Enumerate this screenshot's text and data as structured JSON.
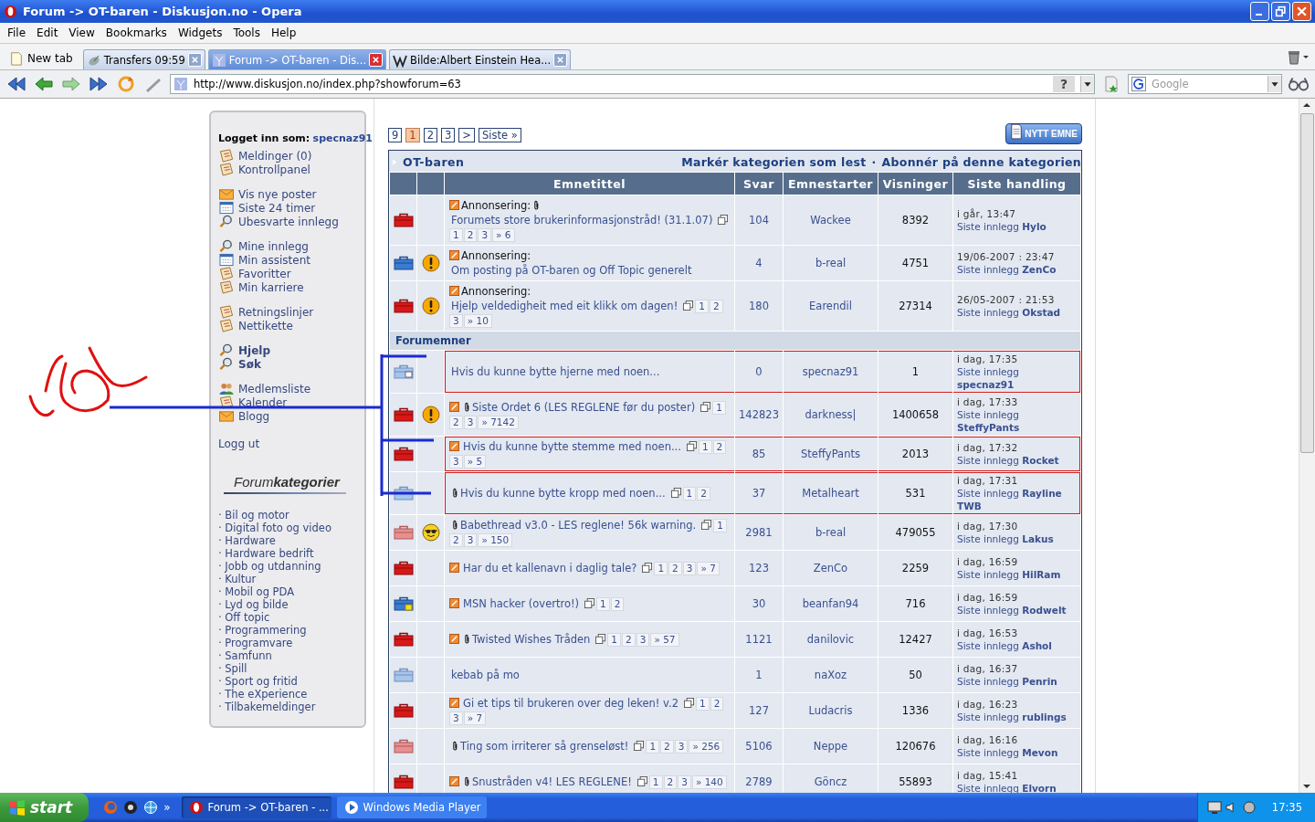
{
  "window": {
    "title": "Forum -> OT-baren - Diskusjon.no - Opera"
  },
  "menu": [
    "File",
    "Edit",
    "View",
    "Bookmarks",
    "Widgets",
    "Tools",
    "Help"
  ],
  "new_tab": "New tab",
  "tabs": [
    {
      "label": "Transfers 09:59",
      "kind": "transfers",
      "selected": false
    },
    {
      "label": "Forum -> OT-baren - Dis...",
      "kind": "page",
      "selected": true
    },
    {
      "label": "Bilde:Albert Einstein Hea...",
      "kind": "wiki",
      "selected": false
    }
  ],
  "address": {
    "url": "http://www.diskusjon.no/index.php?showforum=63",
    "help": "?"
  },
  "search": {
    "placeholder": "Google"
  },
  "sidebar": {
    "login_label": "Logget inn som:",
    "user": "specnaz91",
    "groups": [
      [
        {
          "label": "Meldinger (0)",
          "kind": "notes",
          "bold": false
        },
        {
          "label": "Kontrollpanel",
          "kind": "notes",
          "bold": false
        }
      ],
      [
        {
          "label": "Vis nye poster",
          "kind": "mail",
          "bold": false
        },
        {
          "label": "Siste 24 timer",
          "kind": "calendar",
          "bold": false
        },
        {
          "label": "Ubesvarte innlegg",
          "kind": "search",
          "bold": false
        }
      ],
      [
        {
          "label": "Mine innlegg",
          "kind": "search",
          "bold": false
        },
        {
          "label": "Min assistent",
          "kind": "calendar",
          "bold": false
        },
        {
          "label": "Favoritter",
          "kind": "notes",
          "bold": false
        },
        {
          "label": "Min karriere",
          "kind": "notes",
          "bold": false
        }
      ],
      [
        {
          "label": "Retningslinjer",
          "kind": "notes",
          "bold": false
        },
        {
          "label": "Nettikette",
          "kind": "notes",
          "bold": false
        }
      ],
      [
        {
          "label": "Hjelp",
          "kind": "search",
          "bold": true
        },
        {
          "label": "Søk",
          "kind": "search",
          "bold": true
        }
      ],
      [
        {
          "label": "Medlemsliste",
          "kind": "members",
          "bold": false
        },
        {
          "label": "Kalender",
          "kind": "notes",
          "bold": false
        },
        {
          "label": "Blogg",
          "kind": "mail",
          "bold": false
        }
      ]
    ],
    "logout": "Logg ut",
    "categories_title": "Forum**kategorier**",
    "categories": [
      "· Bil og motor",
      "· Digital foto og video",
      "· Hardware",
      "· Hardware bedrift",
      "· Jobb og utdanning",
      "· Kultur",
      "· Mobil og PDA",
      "· Lyd og bilde",
      "· Off topic",
      "· Programmering",
      "· Programvare",
      "· Samfunn",
      "· Spill",
      "· Sport og fritid",
      "· The eXperience",
      "· Tilbakemeldinger"
    ]
  },
  "pagination": [
    {
      "label": "9",
      "selected": false
    },
    {
      "label": "1",
      "selected": true
    },
    {
      "label": "2",
      "selected": false
    },
    {
      "label": "3",
      "selected": false
    },
    {
      "label": ">",
      "selected": false
    },
    {
      "label": "Siste »",
      "selected": false
    }
  ],
  "new_topic_button": "NYTT EMNE",
  "forum": {
    "title": "OT-baren",
    "actions": [
      "Markér kategorien som lest",
      "Abonnér på denne kategorien"
    ],
    "separator": "·",
    "columns": [
      "Emnetittel",
      "Svar",
      "Emnestarter",
      "Visninger",
      "Siste handling"
    ],
    "pinned": [
      {
        "kind": "hot",
        "new": true,
        "attachment": true,
        "prefix": "Annonsering:",
        "title": "Forumets store brukerinformasjonstråd! (31.1.07)",
        "pages": [
          "1",
          "2",
          "3",
          "» 6"
        ],
        "replies": "104",
        "starter": "Wackee",
        "views": "8392",
        "last_date": "i går, 13:47",
        "last_by": "Siste innlegg **Hylo**",
        "marked": false
      },
      {
        "kind": "new",
        "badge": {
          "kind": "warning"
        },
        "new": true,
        "attachment": false,
        "prefix": "Annonsering:",
        "title": "Om posting på OT-baren og Off Topic generelt",
        "replies": "4",
        "starter": "b-real",
        "views": "4751",
        "last_date": "19/06-2007 : 23:47",
        "last_by": "Siste innlegg **ZenCo**",
        "marked": false
      },
      {
        "kind": "hot",
        "badge": {
          "kind": "warning"
        },
        "new": true,
        "attachment": false,
        "prefix": "Annonsering:",
        "title": "Hjelp veldedigheit med eit klikk om dagen!",
        "pages": [
          "1",
          "2",
          "3",
          "» 10"
        ],
        "replies": "180",
        "starter": "Earendil",
        "views": "27314",
        "last_date": "26/05-2007 : 21:53",
        "last_by": "Siste innlegg **Okstad**",
        "marked": false
      }
    ],
    "section_title": "Forumemner",
    "topics": [
      {
        "kind": "normal-dot",
        "new": false,
        "attachment": false,
        "title": "Hvis du kunne bytte hjerne med noen...",
        "replies": "0",
        "starter": "specnaz91",
        "views": "1",
        "last_date": "i dag, 17:35",
        "last_by": "Siste innlegg **specnaz91**",
        "marked": true
      },
      {
        "kind": "hot",
        "badge": {
          "kind": "warning"
        },
        "new": true,
        "attachment": true,
        "title": "Siste Ordet 6 (LES REGLENE før du poster)",
        "pages": [
          "1",
          "2",
          "3",
          "» 7142"
        ],
        "replies": "142823",
        "starter": "darkness|",
        "views": "1400658",
        "last_date": "i dag, 17:33",
        "last_by": "Siste innlegg **SteffyPants**",
        "marked": false
      },
      {
        "kind": "hot",
        "new": true,
        "attachment": false,
        "title": "Hvis du kunne bytte stemme med noen...",
        "pages": [
          "1",
          "2",
          "3",
          "» 5"
        ],
        "replies": "85",
        "starter": "SteffyPants",
        "views": "2013",
        "last_date": "i dag, 17:32",
        "last_by": "Siste innlegg **Rocket**",
        "marked": true
      },
      {
        "kind": "normal",
        "new": false,
        "attachment": true,
        "title": "Hvis du kunne bytte kropp med noen...",
        "pages": [
          "1",
          "2"
        ],
        "replies": "37",
        "starter": "Metalheart",
        "views": "531",
        "last_date": "i dag, 17:31",
        "last_by": "Siste innlegg **Rayline TWB**",
        "marked": true
      },
      {
        "kind": "hot-read",
        "badge": {
          "kind": "cool"
        },
        "new": false,
        "attachment": true,
        "title": "Babethread v3.0 - LES reglene! 56k warning.",
        "pages": [
          "1",
          "2",
          "3",
          "» 150"
        ],
        "replies": "2981",
        "starter": "b-real",
        "views": "479055",
        "last_date": "i dag, 17:30",
        "last_by": "Siste innlegg **Lakus**",
        "marked": false
      },
      {
        "kind": "hot",
        "new": true,
        "attachment": false,
        "title": "Har du et kallenavn i daglig tale?",
        "pages": [
          "1",
          "2",
          "3",
          "» 7"
        ],
        "replies": "123",
        "starter": "ZenCo",
        "views": "2259",
        "last_date": "i dag, 16:59",
        "last_by": "Siste innlegg **HilRam**",
        "marked": false
      },
      {
        "kind": "new-star",
        "new": true,
        "attachment": false,
        "title": "MSN hacker (overtro!)",
        "pages": [
          "1",
          "2"
        ],
        "replies": "30",
        "starter": "beanfan94",
        "views": "716",
        "last_date": "i dag, 16:59",
        "last_by": "Siste innlegg **Rodwelt**",
        "marked": false
      },
      {
        "kind": "hot",
        "new": true,
        "attachment": true,
        "title": "Twisted Wishes Tråden",
        "pages": [
          "1",
          "2",
          "3",
          "» 57"
        ],
        "replies": "1121",
        "starter": "danilovic",
        "views": "12427",
        "last_date": "i dag, 16:53",
        "last_by": "Siste innlegg **Ashol**",
        "marked": false
      },
      {
        "kind": "normal",
        "new": false,
        "attachment": false,
        "title": "kebab på mo",
        "replies": "1",
        "starter": "naXoz",
        "views": "50",
        "last_date": "i dag, 16:37",
        "last_by": "Siste innlegg **Penrin**",
        "marked": false
      },
      {
        "kind": "hot",
        "new": true,
        "attachment": false,
        "title": "Gi et tips til brukeren over deg leken! v.2",
        "pages": [
          "1",
          "2",
          "3",
          "» 7"
        ],
        "replies": "127",
        "starter": "Ludacris",
        "views": "1336",
        "last_date": "i dag, 16:23",
        "last_by": "Siste innlegg **rublings**",
        "marked": false
      },
      {
        "kind": "hot-read",
        "new": false,
        "attachment": true,
        "title": "Ting som irriterer så grenseløst!",
        "pages": [
          "1",
          "2",
          "3",
          "» 256"
        ],
        "replies": "5106",
        "starter": "Neppe",
        "views": "120676",
        "last_date": "i dag, 16:16",
        "last_by": "Siste innlegg **Mevon**",
        "marked": false
      },
      {
        "kind": "hot",
        "new": true,
        "attachment": true,
        "title": "Snustråden v4! LES REGLENE!",
        "pages": [
          "1",
          "2",
          "3",
          "» 140"
        ],
        "replies": "2789",
        "starter": "Göncz",
        "views": "55893",
        "last_date": "i dag, 15:41",
        "last_by": "Siste innlegg **Elvorn**",
        "marked": false
      }
    ]
  },
  "taskbar": {
    "start": "start",
    "more": "»",
    "tasks": [
      {
        "label": "Forum -> OT-baren - ...",
        "kind": "opera",
        "selected": true
      },
      {
        "label": "Windows Media Player",
        "kind": "media",
        "selected": false
      }
    ],
    "clock": "17:35"
  }
}
